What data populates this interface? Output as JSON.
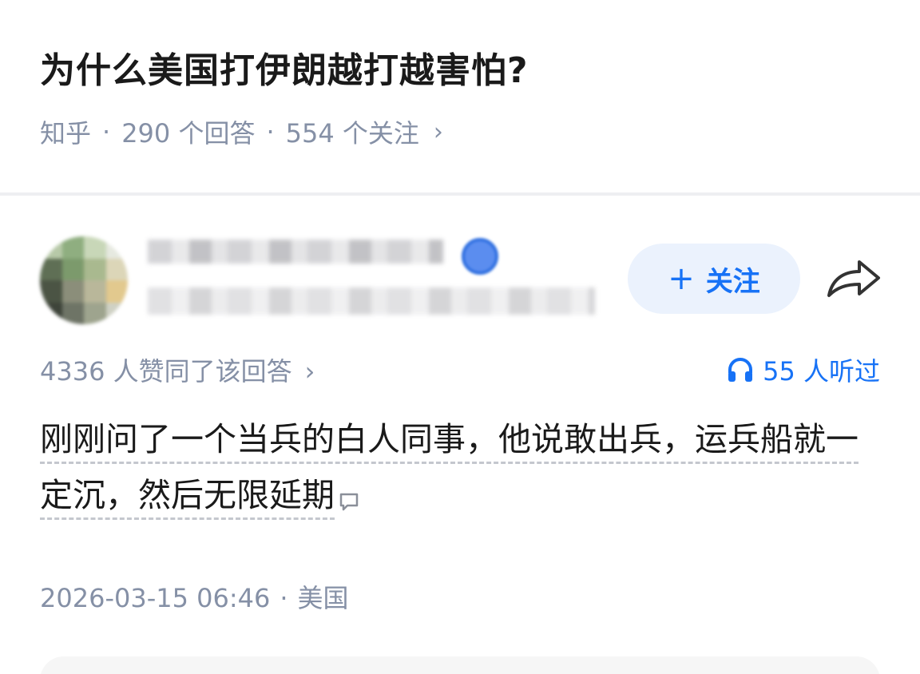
{
  "question": {
    "title": "为什么美国打伊朗越打越害怕?",
    "source": "知乎",
    "answers_count": "290 个回答",
    "followers_count": "554 个关注",
    "chevron": "›"
  },
  "author": {
    "follow_label": "关注",
    "follow_plus": "+"
  },
  "stats": {
    "upvote_text": "4336 人赞同了该回答",
    "chevron": "›",
    "listen_text": "55 人听过"
  },
  "answer": {
    "content": "刚刚问了一个当兵的白人同事，他说敢出兵，运兵船就一定沉，然后无限延期"
  },
  "meta": {
    "date": "2026-03-15 06:46",
    "location": "美国",
    "separator": "·"
  },
  "colors": {
    "accent": "#1772f6",
    "follow_bg": "#ebf2fd",
    "meta_gray": "#8590a6",
    "text": "#1a1a1a"
  }
}
